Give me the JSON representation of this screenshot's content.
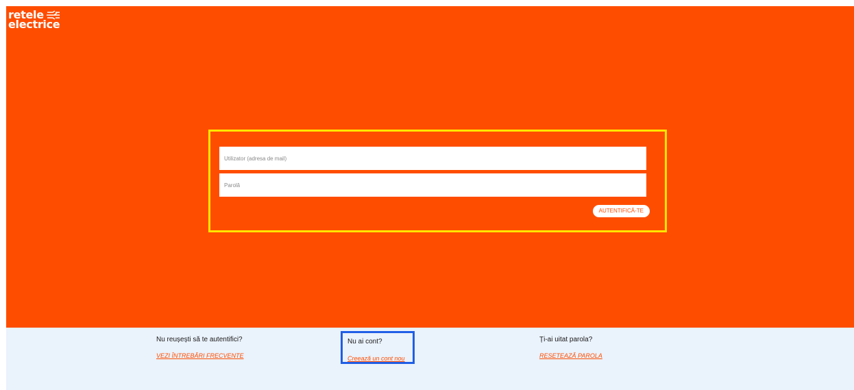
{
  "logo": {
    "line1": "retele",
    "line2": "electrice"
  },
  "login": {
    "username_placeholder": "Utilizator (adresa de mail)",
    "password_placeholder": "Parolă",
    "submit_label": "AUTENTIFICĂ-TE"
  },
  "footer": {
    "help": {
      "question": "Nu reușești să te autentifici?",
      "link": "VEZI ÎNTREBĂRI FRECVENTE"
    },
    "register": {
      "question": "Nu ai cont?",
      "link": "Creează un cont nou"
    },
    "reset": {
      "question": "Ți-ai uitat parola?",
      "link": "RESETEAZĂ PAROLA"
    }
  },
  "colors": {
    "brand_orange": "#ff4d00",
    "highlight_yellow": "#ffe600",
    "highlight_blue": "#1f5ee6",
    "footer_bg": "#eaf2fb"
  },
  "icons": {
    "logo_mark": "lightning-lines-icon"
  }
}
